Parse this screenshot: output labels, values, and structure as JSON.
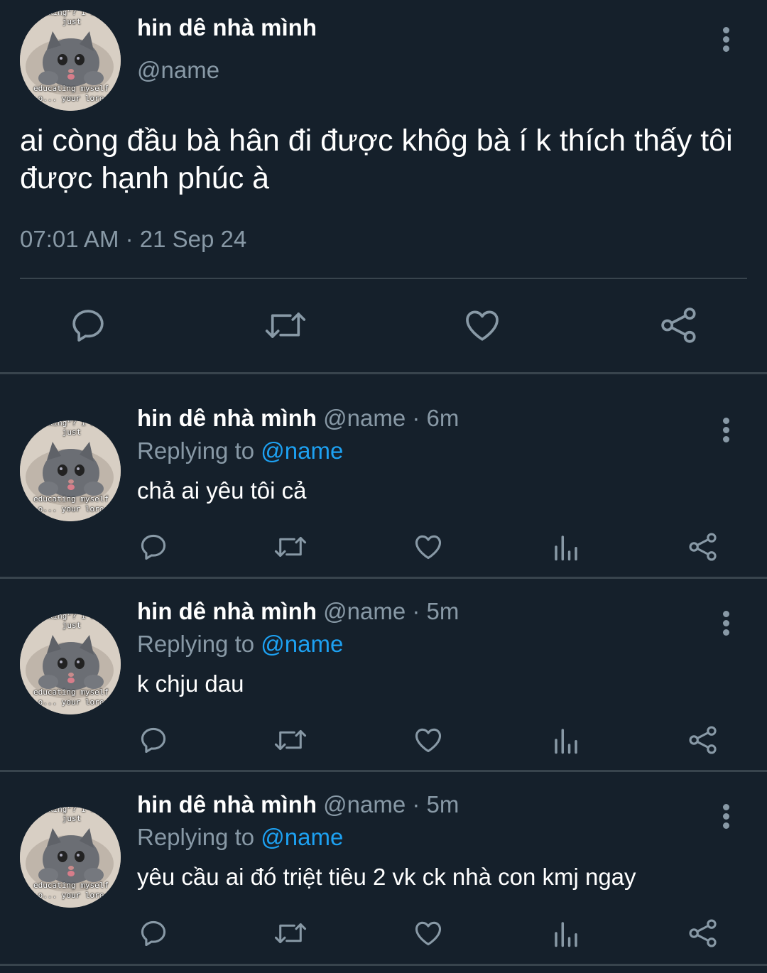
{
  "main_tweet": {
    "display_name": "hin dê nhà mình",
    "handle": "@name",
    "text": "ai còng đầu bà hân đi được khôg bà í k thích thấy tôi được hạnh phúc à",
    "timestamp": "07:01 AM · 21 Sep 24",
    "avatar_caption_top": "talking\"? i w... just",
    "avatar_caption_bottom": "educating myself o... your lore",
    "actions": [
      "reply-icon",
      "retweet-icon",
      "like-icon",
      "share-icon"
    ]
  },
  "replies": [
    {
      "display_name": "hin dê nhà mình",
      "meta": "@name · 6m",
      "replying_prefix": "Replying to",
      "replying_handle": "@name",
      "text": "chả ai yêu tôi cả"
    },
    {
      "display_name": "hin dê nhà mình",
      "meta": "@name · 5m",
      "replying_prefix": "Replying to",
      "replying_handle": "@name",
      "text": "k chju dau"
    },
    {
      "display_name": "hin dê nhà mình",
      "meta": "@name · 5m",
      "replying_prefix": "Replying to",
      "replying_handle": "@name",
      "text": "yêu cầu ai đó triệt tiêu 2 vk ck nhà con kmj ngay"
    }
  ],
  "reply_actions": [
    "reply-icon",
    "retweet-icon",
    "like-icon",
    "analytics-icon",
    "share-icon"
  ],
  "colors": {
    "background": "#15202b",
    "divider": "#38444d",
    "secondary_text": "#8899a6",
    "link": "#1da1f2",
    "primary_text": "#ffffff"
  }
}
